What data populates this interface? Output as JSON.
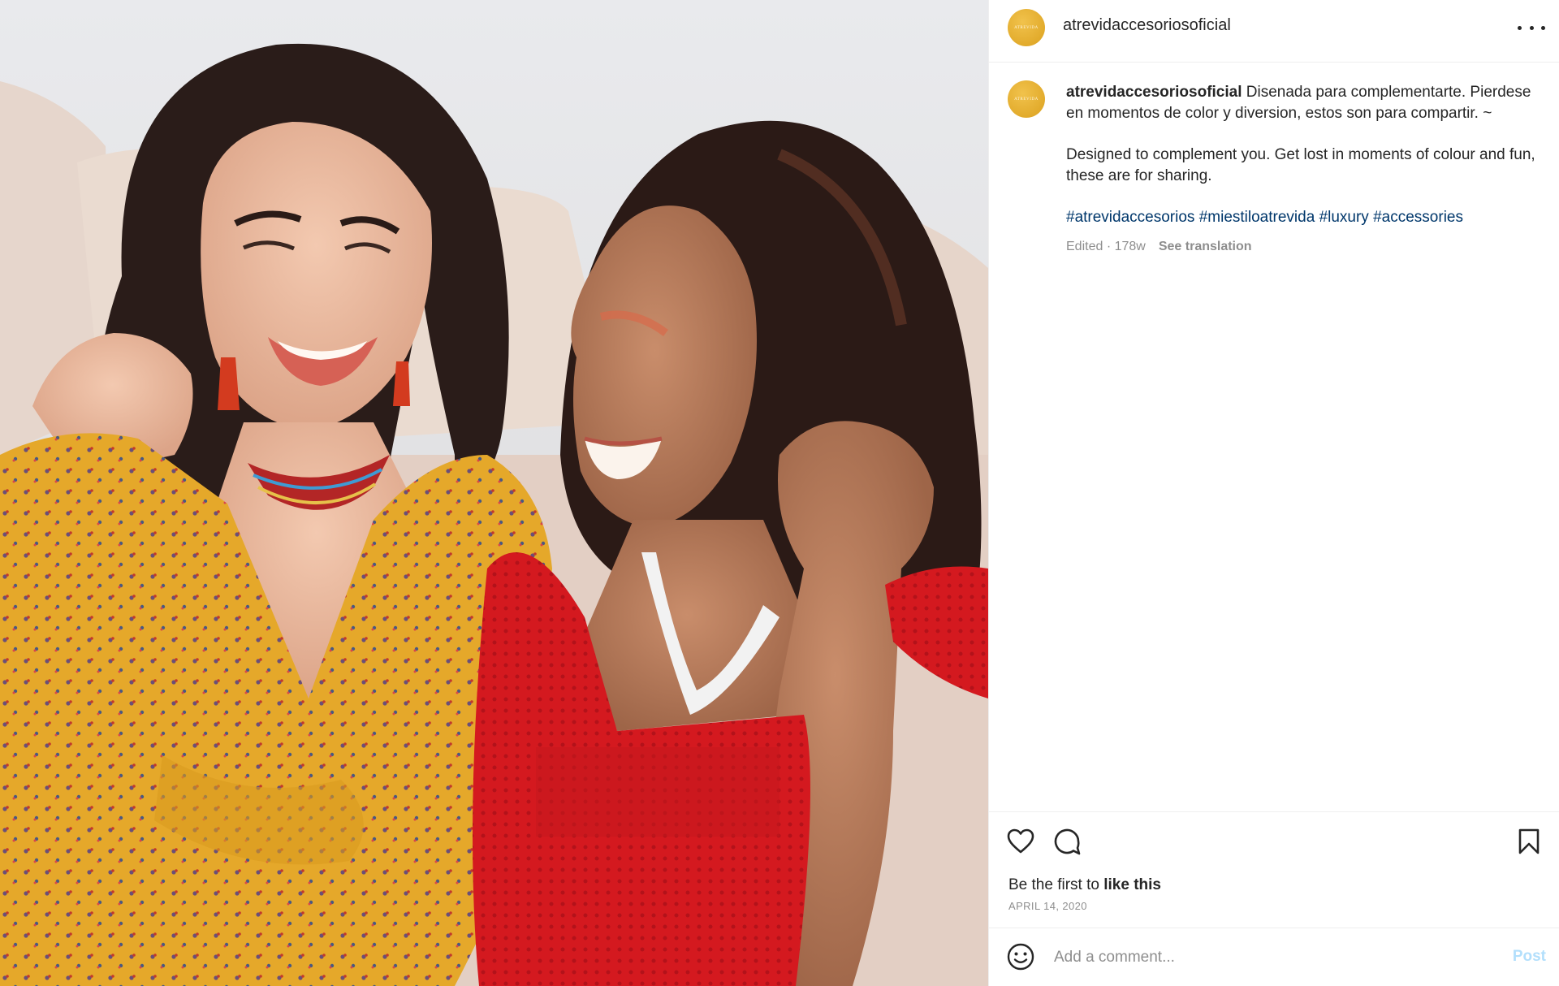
{
  "post": {
    "username": "atrevidaccesoriosoficial",
    "avatar_text": "ATREVIDA",
    "caption": {
      "line_es": "Disenada para complementarte. Pierdese en momentos de color y diversion, estos son para compartir. ~",
      "line_en": "Designed to complement you. Get lost in moments of colour and fun, these are for sharing.",
      "hashtags": [
        "#atrevidaccesorios",
        "#miestiloatrevida",
        "#luxury",
        "#accessories"
      ]
    },
    "edited_label": "Edited · 178w",
    "see_translation": "See translation",
    "likes_prefix": "Be the first to",
    "likes_action": "like this",
    "date": "APRIL 14, 2020"
  },
  "comment": {
    "placeholder": "Add a comment...",
    "post_label": "Post"
  },
  "icons": {
    "more": "more-options-icon",
    "like": "heart-icon",
    "comment": "comment-bubble-icon",
    "save": "bookmark-icon",
    "emoji": "smiley-icon"
  },
  "colors": {
    "avatar": "#e2ab2c",
    "hashtag_link": "#00376b",
    "post_disabled": "#b2dffc",
    "muted_text": "#8e8e8e"
  },
  "photo_description_alt": ""
}
